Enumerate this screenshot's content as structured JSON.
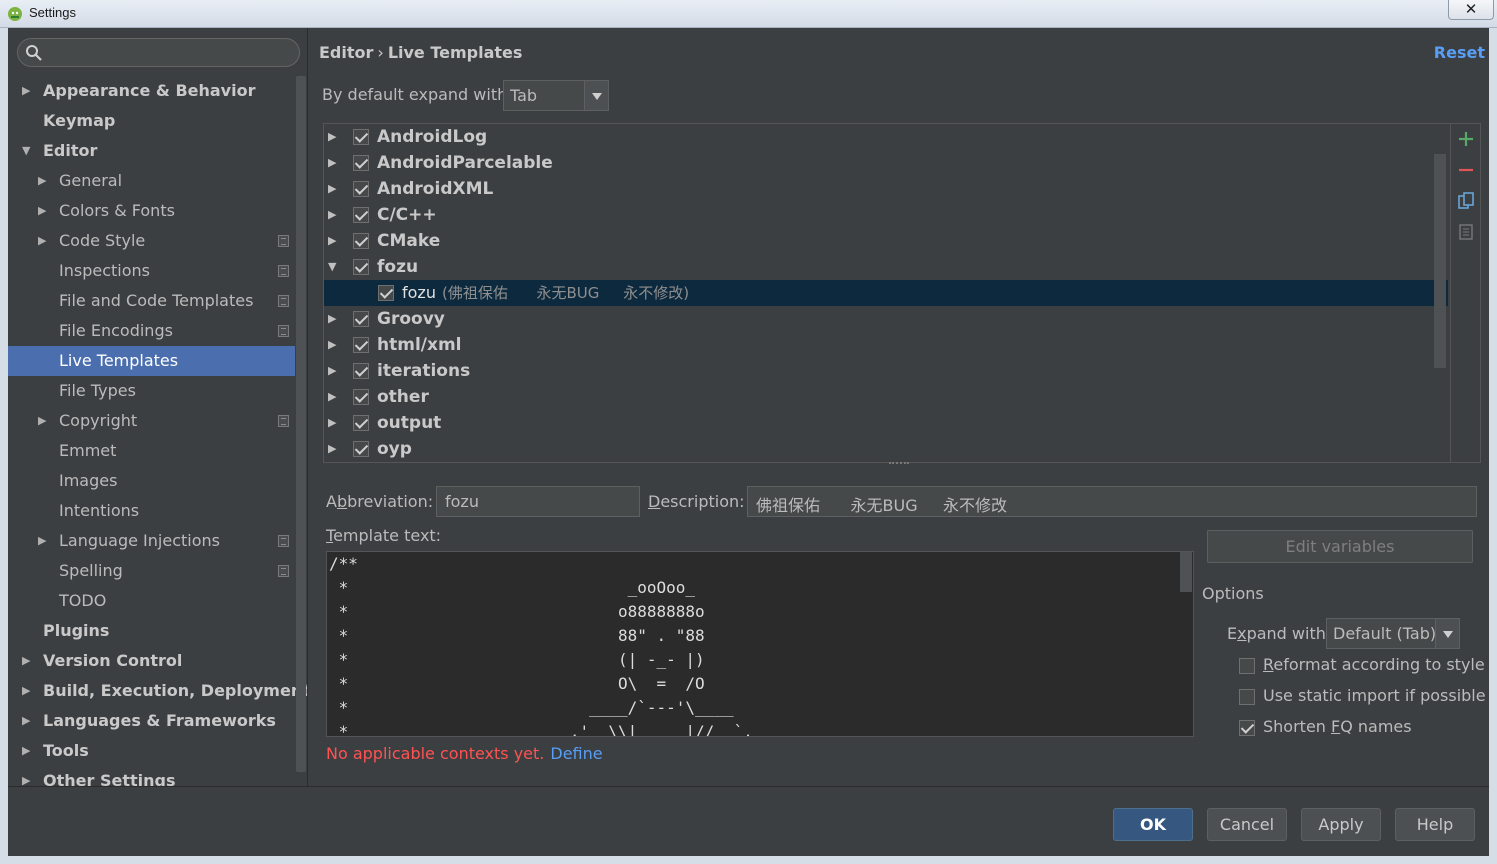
{
  "window": {
    "title": "Settings",
    "close_glyph": "✕"
  },
  "search": {
    "placeholder": "",
    "icon": "search-icon"
  },
  "sidebar": {
    "items": [
      {
        "label": "Appearance & Behavior",
        "level": 0,
        "bold": true,
        "arrow": "▶"
      },
      {
        "label": "Keymap",
        "level": 0,
        "bold": true,
        "arrow": ""
      },
      {
        "label": "Editor",
        "level": 0,
        "bold": true,
        "arrow": "▼"
      },
      {
        "label": "General",
        "level": 1,
        "arrow": "▶"
      },
      {
        "label": "Colors & Fonts",
        "level": 1,
        "arrow": "▶"
      },
      {
        "label": "Code Style",
        "level": 1,
        "arrow": "▶",
        "project": true
      },
      {
        "label": "Inspections",
        "level": 1,
        "arrow": "",
        "project": true
      },
      {
        "label": "File and Code Templates",
        "level": 1,
        "arrow": "",
        "project": true
      },
      {
        "label": "File Encodings",
        "level": 1,
        "arrow": "",
        "project": true
      },
      {
        "label": "Live Templates",
        "level": 1,
        "arrow": "",
        "selected": true
      },
      {
        "label": "File Types",
        "level": 1,
        "arrow": ""
      },
      {
        "label": "Copyright",
        "level": 1,
        "arrow": "▶",
        "project": true
      },
      {
        "label": "Emmet",
        "level": 1,
        "arrow": ""
      },
      {
        "label": "Images",
        "level": 1,
        "arrow": ""
      },
      {
        "label": "Intentions",
        "level": 1,
        "arrow": ""
      },
      {
        "label": "Language Injections",
        "level": 1,
        "arrow": "▶",
        "project": true
      },
      {
        "label": "Spelling",
        "level": 1,
        "arrow": "",
        "project": true
      },
      {
        "label": "TODO",
        "level": 1,
        "arrow": ""
      },
      {
        "label": "Plugins",
        "level": 0,
        "bold": true,
        "arrow": ""
      },
      {
        "label": "Version Control",
        "level": 0,
        "bold": true,
        "arrow": "▶"
      },
      {
        "label": "Build, Execution, Deployment",
        "level": 0,
        "bold": true,
        "arrow": "▶"
      },
      {
        "label": "Languages & Frameworks",
        "level": 0,
        "bold": true,
        "arrow": "▶"
      },
      {
        "label": "Tools",
        "level": 0,
        "bold": true,
        "arrow": "▶"
      },
      {
        "label": "Other Settings",
        "level": 0,
        "bold": true,
        "arrow": "▶"
      }
    ]
  },
  "header": {
    "crumb_parent": "Editor",
    "crumb_sep": "›",
    "crumb_current": "Live Templates",
    "reset_label": "Reset"
  },
  "expand": {
    "label": "By default expand with",
    "value": "Tab"
  },
  "templates": [
    {
      "name": "AndroidLog",
      "checked": true,
      "arrow": "▶"
    },
    {
      "name": "AndroidParcelable",
      "checked": true,
      "arrow": "▶"
    },
    {
      "name": "AndroidXML",
      "checked": true,
      "arrow": "▶"
    },
    {
      "name": "C/C++",
      "checked": true,
      "arrow": "▶"
    },
    {
      "name": "CMake",
      "checked": true,
      "arrow": "▶"
    },
    {
      "name": "fozu",
      "checked": true,
      "arrow": "▼"
    },
    {
      "name": "fozu",
      "desc": "(佛祖保佑      永无BUG     永不修改)",
      "checked": true,
      "child": true,
      "selected": true
    },
    {
      "name": "Groovy",
      "checked": true,
      "arrow": "▶"
    },
    {
      "name": "html/xml",
      "checked": true,
      "arrow": "▶"
    },
    {
      "name": "iterations",
      "checked": true,
      "arrow": "▶"
    },
    {
      "name": "other",
      "checked": true,
      "arrow": "▶"
    },
    {
      "name": "output",
      "checked": true,
      "arrow": "▶"
    },
    {
      "name": "oyp",
      "checked": true,
      "arrow": "▶"
    }
  ],
  "list_tools": [
    "add-icon",
    "remove-icon",
    "copy-icon",
    "restore-icon"
  ],
  "abbreviation": {
    "label_pre": "A",
    "label_u": "b",
    "label_post": "breviation:",
    "value": "fozu"
  },
  "description": {
    "label_u": "D",
    "label_post": "escription:",
    "value": "佛祖保佑      永无BUG     永不修改"
  },
  "template_text": {
    "label_u": "T",
    "label_post": "emplate text:",
    "content": "/**\n *                             _ooOoo_\n *                            o8888888o\n *                            88\" . \"88\n *                            (| -_- |)\n *                            O\\  =  /O\n *                         ____/`---'\\____\n *                       .'  \\\\|     |//  `."
  },
  "edit_variables_label": "Edit variables",
  "options": {
    "title": "Options",
    "expand_label_pre": "E",
    "expand_label_u": "x",
    "expand_label_post": "pand with",
    "expand_value": "Default (Tab)",
    "reformat": {
      "label_u": "R",
      "label_post": "eformat according to style",
      "checked": false
    },
    "static_import": {
      "label": "Use static import if possible",
      "checked": false
    },
    "shorten": {
      "label_pre": "Shorten ",
      "label_u": "F",
      "label_post": "Q names",
      "checked": true
    }
  },
  "context": {
    "error": "No applicable contexts yet.",
    "define": "Define"
  },
  "buttons": {
    "ok": "OK",
    "cancel": "Cancel",
    "apply": "Apply",
    "help": "Help"
  },
  "colors": {
    "accent": "#4b6eaf",
    "link": "#589df6",
    "error": "#ff5252",
    "selected_row": "#0d293e"
  }
}
